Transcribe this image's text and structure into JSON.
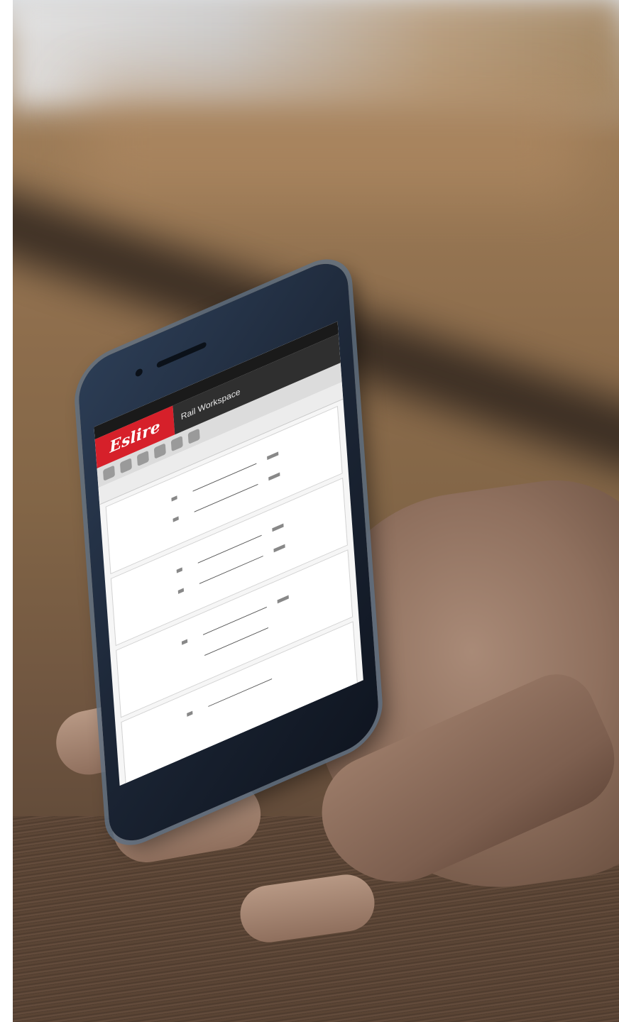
{
  "scene": {
    "colors": {
      "wall": "#d9dadb",
      "wood": "#8d6d4c",
      "beam": "#2e241d",
      "skin": "#9c7c69",
      "phone_body": "#1c2636",
      "app_red": "#d6202a",
      "app_dark": "#2f2f2f"
    }
  },
  "phone_screen": {
    "brand_logo": "Eslire",
    "workspace_title": "Rail Workspace",
    "card_count_visible": 4
  }
}
